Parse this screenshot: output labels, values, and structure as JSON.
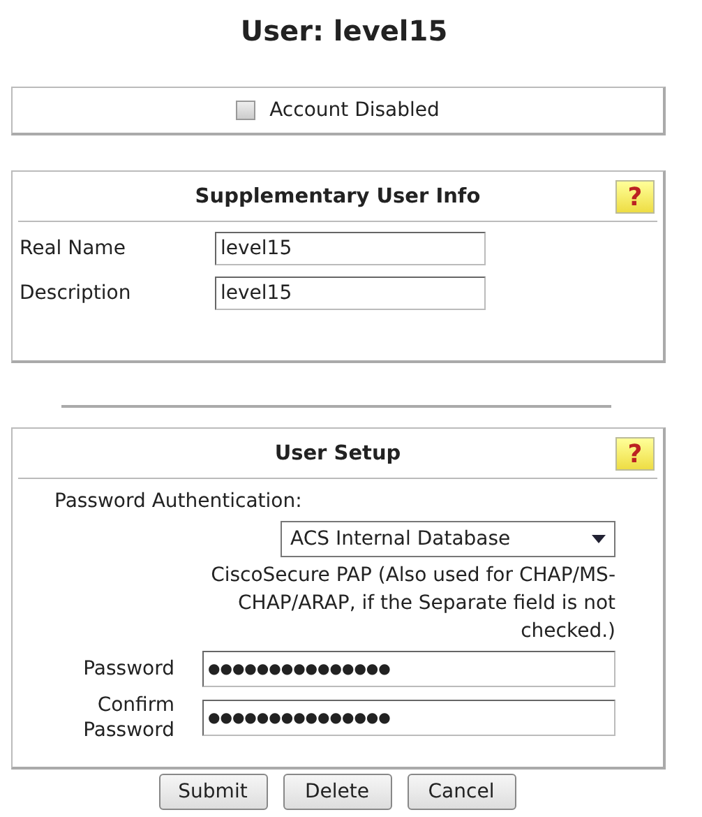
{
  "title": "User: level15",
  "account": {
    "label": "Account Disabled",
    "checked": false
  },
  "supplementary": {
    "title": "Supplementary User Info",
    "help": "?",
    "fields": [
      {
        "label": "Real Name",
        "value": "level15"
      },
      {
        "label": "Description",
        "value": "level15"
      }
    ]
  },
  "user_setup": {
    "title": "User Setup",
    "help": "?",
    "auth_label": "Password Authentication:",
    "auth_value": "ACS Internal Database",
    "note": "CiscoSecure PAP (Also used for CHAP/MS-CHAP/ARAP, if the Separate field is not checked.)",
    "fields": [
      {
        "label": "Password",
        "value": "●●●●●●●●●●●●●●●"
      },
      {
        "label": "Confirm Password",
        "value": "●●●●●●●●●●●●●●●"
      }
    ]
  },
  "buttons": [
    "Submit",
    "Delete",
    "Cancel"
  ]
}
